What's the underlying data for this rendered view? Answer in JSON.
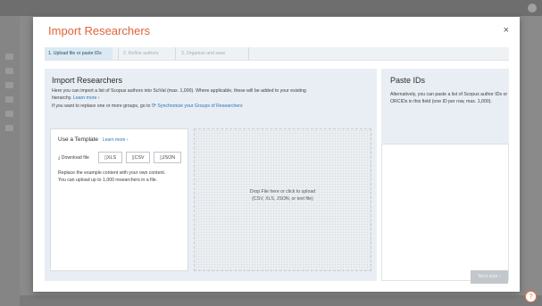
{
  "modal": {
    "title": "Import Researchers",
    "close_glyph": "×"
  },
  "steps": [
    {
      "label": "1. Upload file or paste IDs"
    },
    {
      "label": "2. Refine authors"
    },
    {
      "label": "3. Organize and save"
    }
  ],
  "import_panel": {
    "heading": "Import Researchers",
    "desc_line1": "Here you can import a list of Scopus authors into SciVal (max. 1,000). Where applicable, these will be added to your existing",
    "desc_line2_text": "hierarchy.",
    "desc_line2_link": "Learn more ›",
    "replace_text": "If you want to replace one or more groups, go to",
    "replace_link": "Synchronize your Groups of Researchers"
  },
  "template": {
    "title": "Use a Template",
    "learn_more": "Learn more ›",
    "download_label": "⤓ Download file",
    "buttons": {
      "xls": "XLS",
      "csv": "CSV",
      "json": "JSON"
    },
    "desc_line1": "Replace the example content with your own content.",
    "desc_line2": "You can upload up to 1,000 researchers in a file."
  },
  "dropzone": {
    "line1": "Drop File here or click to upload",
    "line2": "(CSV, XLS, JSON, or text file)"
  },
  "paste_panel": {
    "heading": "Paste IDs",
    "desc_line1": "Alternatively, you can paste a list of Scopus author IDs or",
    "desc_line2": "ORCIDs in this field (one ID per row, max. 1,000)."
  },
  "next_button": "Next step ›",
  "help_glyph": "?",
  "colors": {
    "title_accent": "#e0643a",
    "link": "#2a73b5",
    "panel_bg": "#e8eef3"
  }
}
